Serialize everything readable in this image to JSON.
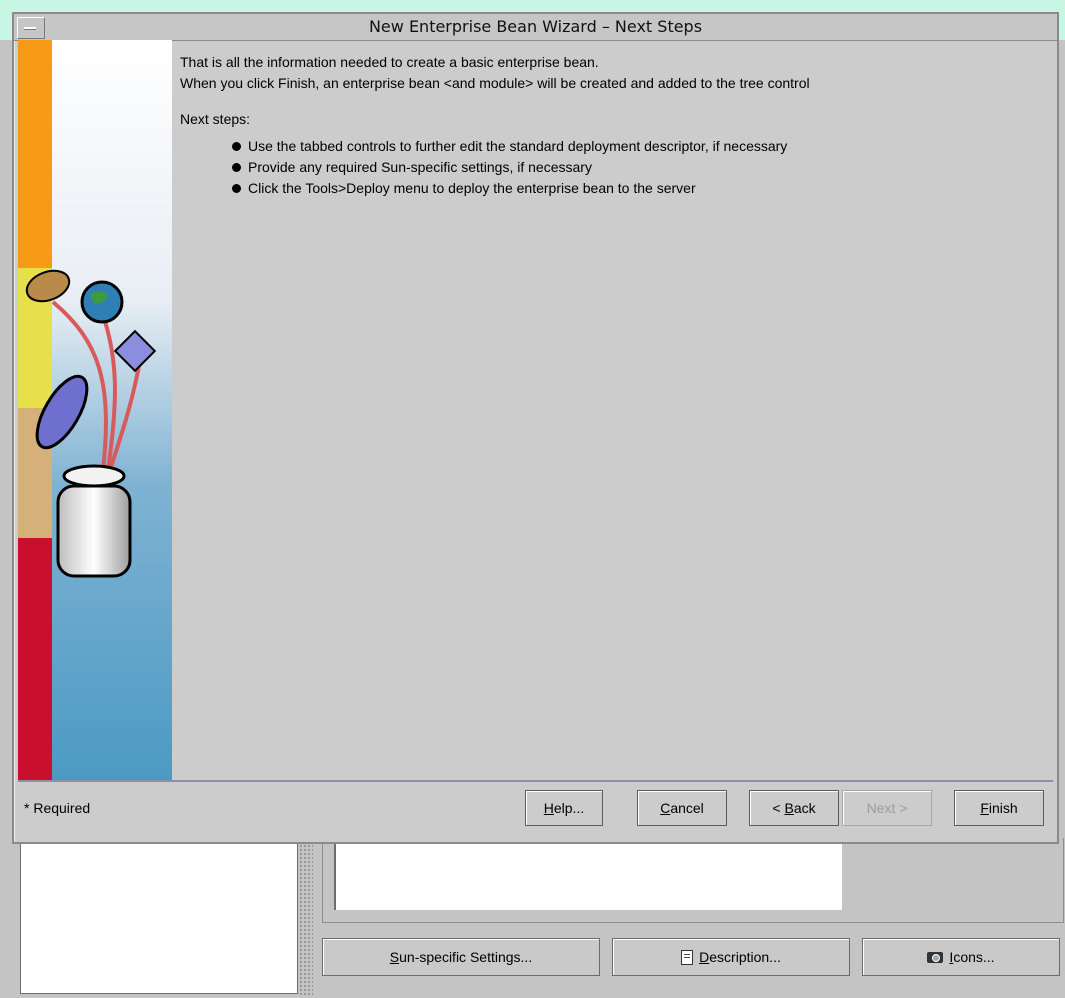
{
  "dialog": {
    "title": "New Enterprise Bean Wizard – Next Steps",
    "intro_line1": "That is all the information needed to create a basic enterprise bean.",
    "intro_line2": "When you click Finish, an enterprise bean <and module> will be created and added to the tree control",
    "next_steps_heading": "Next steps:",
    "steps": [
      "Use the tabbed controls to further edit the standard deployment descriptor, if necessary",
      "Provide any required Sun-specific settings, if necessary",
      "Click the Tools>Deploy menu to deploy the enterprise bean to the server"
    ],
    "required_label": "* Required",
    "buttons": {
      "help": {
        "mnemonic": "H",
        "rest": "elp..."
      },
      "cancel": {
        "mnemonic": "C",
        "rest": "ancel"
      },
      "back": {
        "prefix": "< ",
        "mnemonic": "B",
        "rest": "ack"
      },
      "next": {
        "label": "Next >",
        "enabled": false
      },
      "finish": {
        "mnemonic": "F",
        "rest": "inish"
      }
    }
  },
  "background": {
    "buttons": {
      "sun_settings": {
        "mnemonic": "S",
        "rest": "un-specific Settings..."
      },
      "description": {
        "mnemonic": "D",
        "rest": "escription...",
        "icon": "document-icon"
      },
      "icons": {
        "mnemonic": "I",
        "rest": "cons...",
        "icon": "camera-icon"
      }
    }
  },
  "colors": {
    "dialog_bg": "#cccccc",
    "desktop_bg": "#c8f6e4",
    "banner_blue": "#4b9ac4",
    "banner_orange": "#f79a16",
    "banner_red": "#c8102e"
  }
}
